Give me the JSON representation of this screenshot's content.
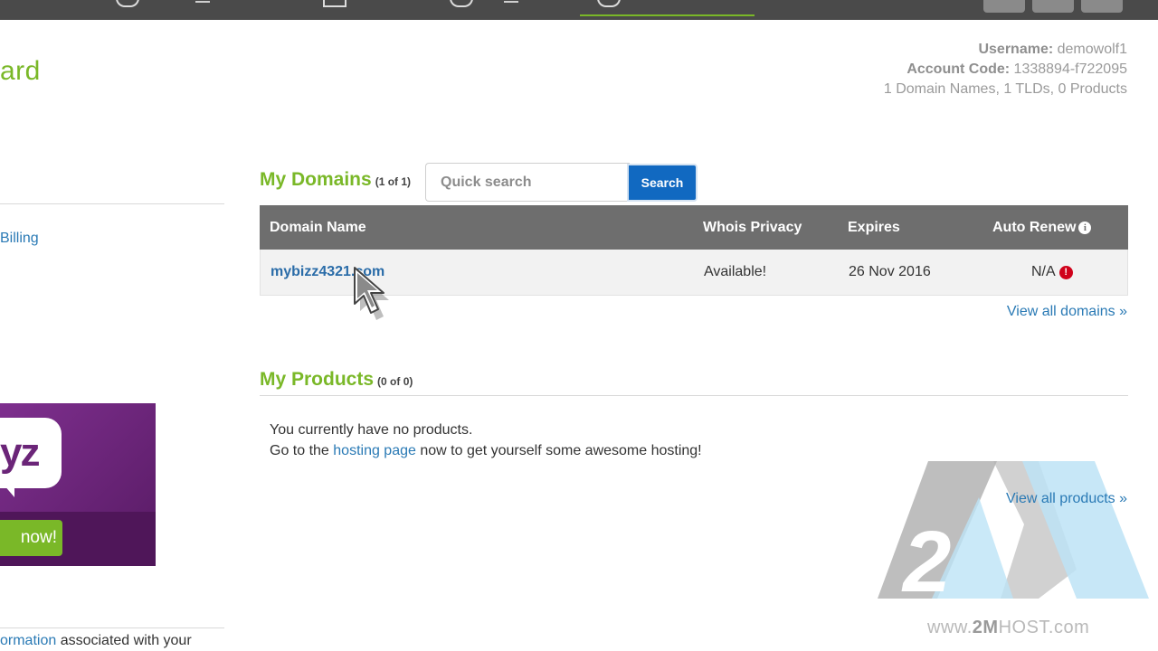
{
  "header": {
    "page_title": "ard"
  },
  "account": {
    "username_label": "Username:",
    "username": "demowolf1",
    "account_code_label": "Account Code:",
    "account_code": "1338894-f722095",
    "summary": "1 Domain Names, 1 TLDs, 0 Products"
  },
  "sidebar": {
    "billing_link": "Billing",
    "promo_text": "yz",
    "promo_button": "now!",
    "bottom_link": "ormation",
    "bottom_text": " associated with your"
  },
  "domains": {
    "title": "My Domains",
    "count": "(1 of 1)",
    "search_placeholder": "Quick search",
    "search_button": "Search",
    "columns": {
      "name": "Domain Name",
      "privacy": "Whois Privacy",
      "expires": "Expires",
      "auto_renew": "Auto Renew"
    },
    "rows": [
      {
        "name": "mybizz4321.com",
        "privacy": "Available!",
        "expires": "26 Nov 2016",
        "auto_renew": "N/A"
      }
    ],
    "view_all": "View all domains »"
  },
  "products": {
    "title": "My Products",
    "count": "(0 of 0)",
    "empty_line1": "You currently have no products.",
    "empty_line2_prefix": "Go to the ",
    "empty_line2_link": "hosting page",
    "empty_line2_suffix": " now to get yourself some awesome hosting!",
    "view_all": "View all products »"
  },
  "watermark": {
    "url_prefix": "www.",
    "url_bold": "2M",
    "url_suffix": "HOST.com",
    "logo_digit": "2"
  },
  "colors": {
    "brand_green": "#7ab828",
    "link_blue": "#2a7ab5",
    "search_blue": "#1169c1",
    "table_header": "#6e6e6e",
    "alert_red": "#d0021b"
  }
}
